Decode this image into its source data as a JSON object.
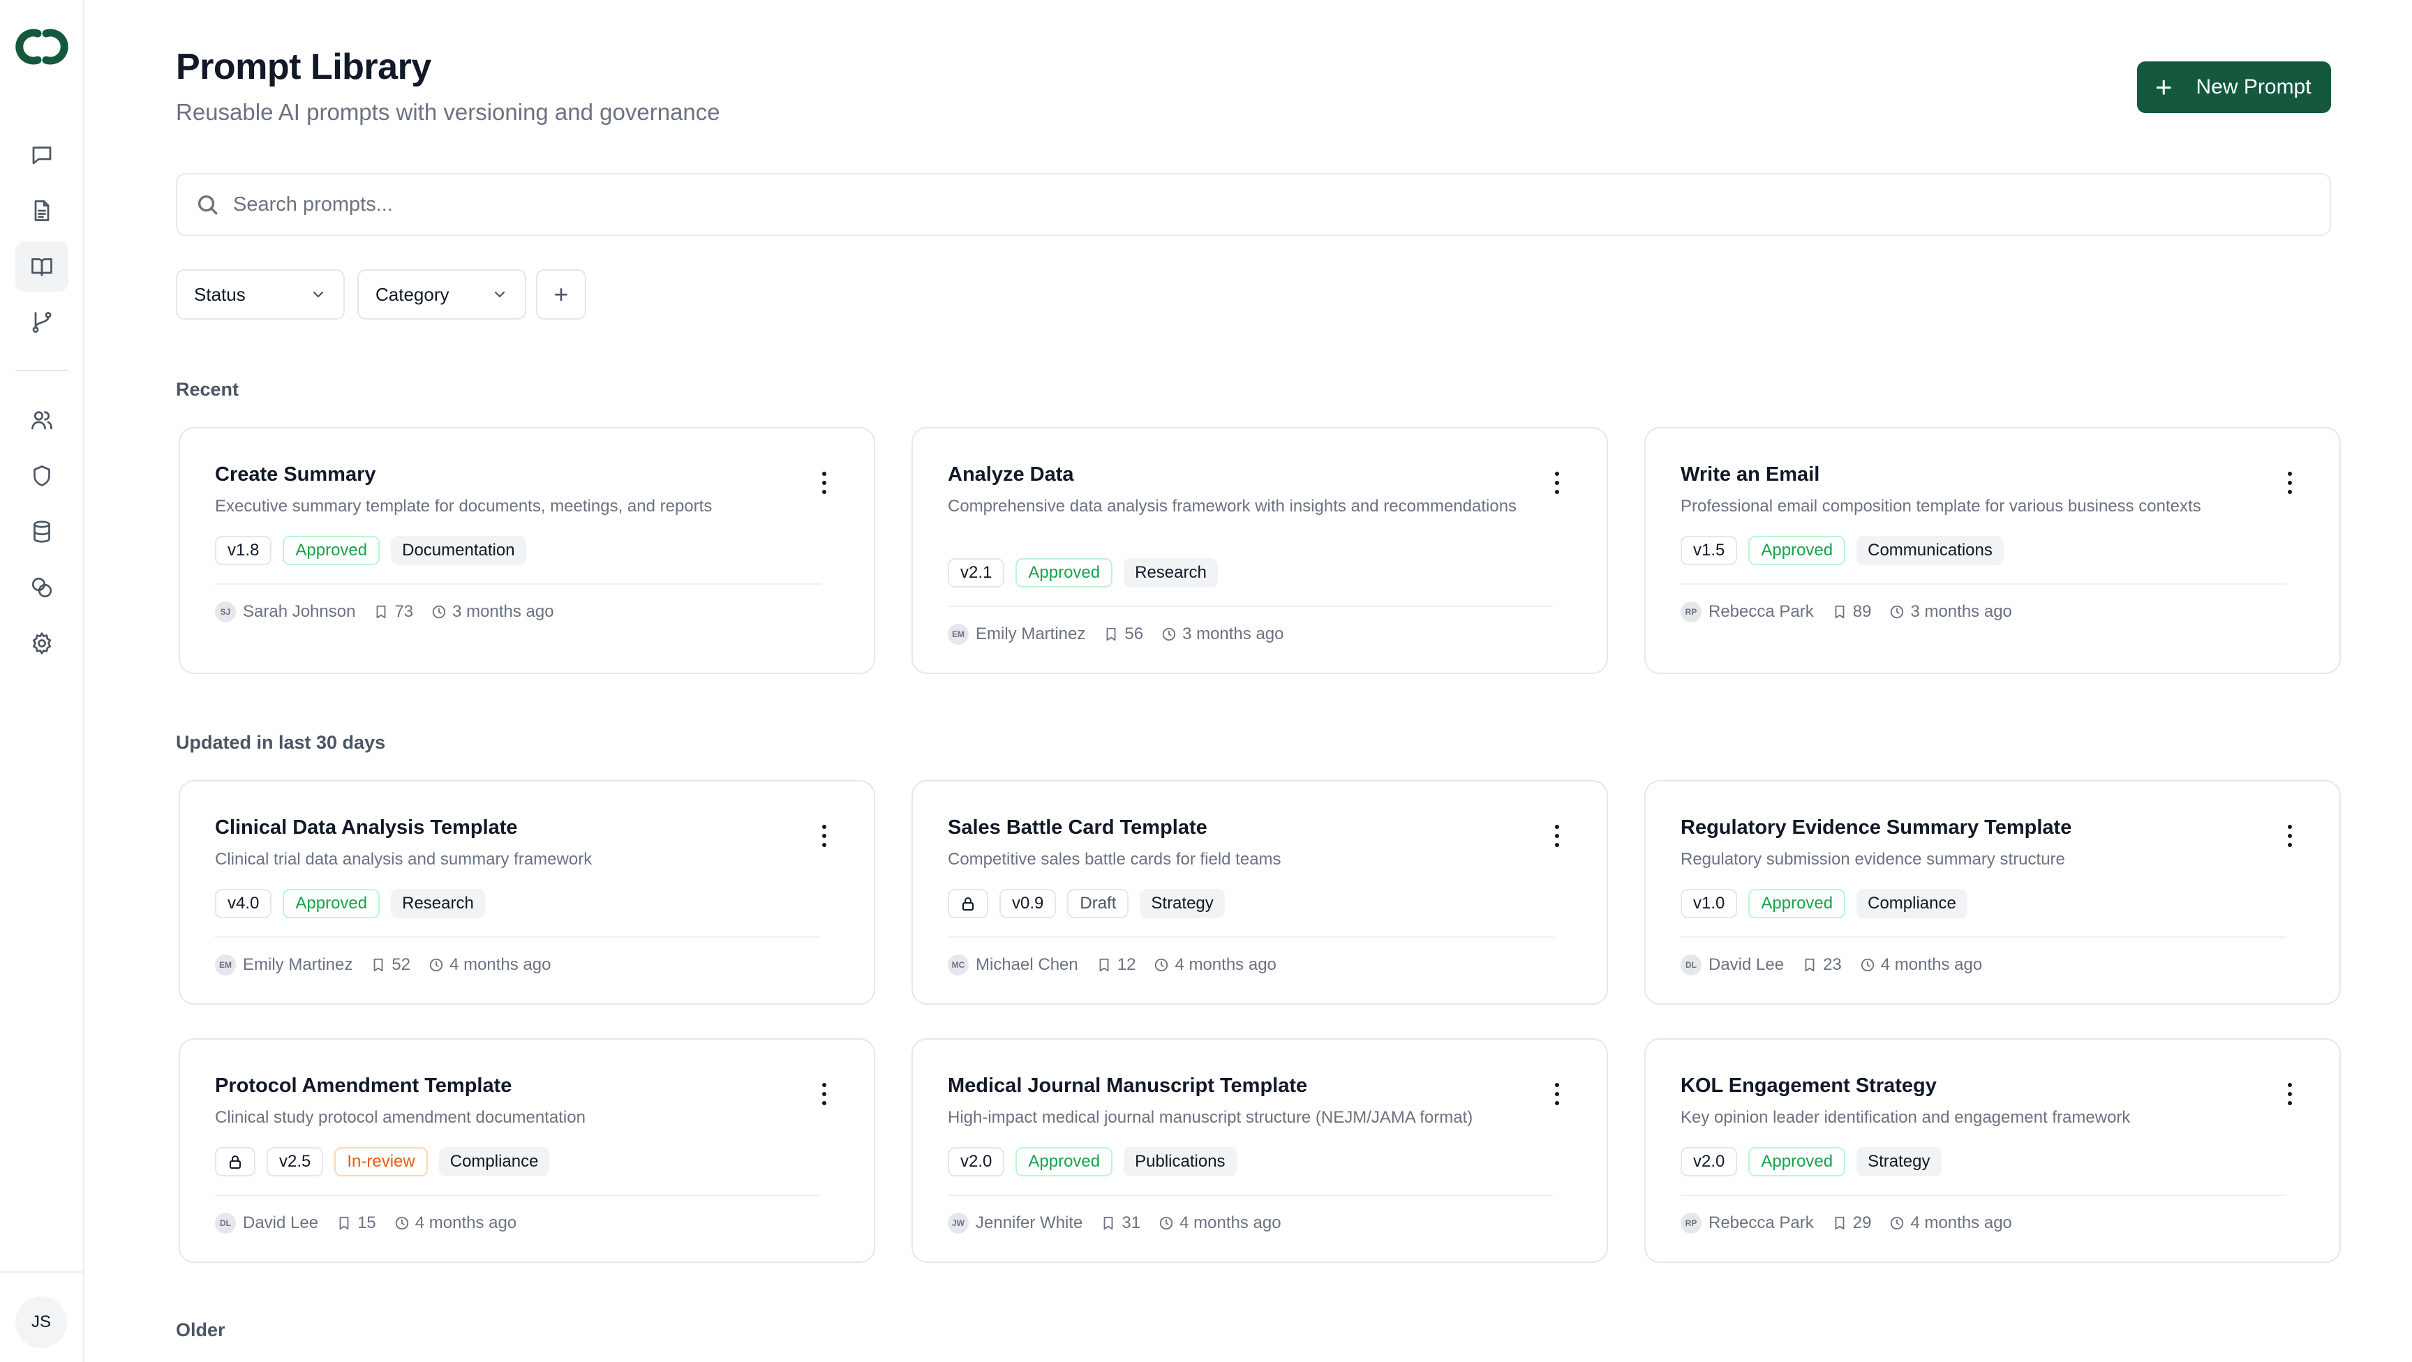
{
  "sidebar": {
    "nav": [
      {
        "name": "chat-icon",
        "active": false
      },
      {
        "name": "document-icon",
        "active": false
      },
      {
        "name": "book-open-icon",
        "active": true
      },
      {
        "name": "git-branch-icon",
        "active": false
      },
      {
        "name": "users-icon",
        "active": false
      },
      {
        "name": "shield-icon",
        "active": false
      },
      {
        "name": "database-icon",
        "active": false
      },
      {
        "name": "coins-icon",
        "active": false
      },
      {
        "name": "gear-icon",
        "active": false
      }
    ],
    "user_initials": "JS"
  },
  "header": {
    "title": "Prompt Library",
    "subtitle": "Reusable AI prompts with versioning and governance",
    "new_button": "New Prompt"
  },
  "search": {
    "placeholder": "Search prompts..."
  },
  "filters": {
    "status": "Status",
    "category": "Category",
    "add": "+"
  },
  "colors": {
    "brand": "#14593d",
    "approved": "#16a34a",
    "in_review": "#ea580c"
  },
  "sections": {
    "recent": "Recent",
    "updated": "Updated in last 30 days",
    "older": "Older"
  },
  "cards": {
    "recent": [
      {
        "title": "Create Summary",
        "desc": "Executive summary template for documents, meetings, and reports",
        "locked": false,
        "version": "v1.8",
        "status": "Approved",
        "status_type": "approved",
        "category": "Documentation",
        "initials": "SJ",
        "author": "Sarah Johnson",
        "uses": "73",
        "time": "3 months ago"
      },
      {
        "title": "Analyze Data",
        "desc": "Comprehensive data analysis framework with insights and recommendations",
        "locked": false,
        "version": "v2.1",
        "status": "Approved",
        "status_type": "approved",
        "category": "Research",
        "initials": "EM",
        "author": "Emily Martinez",
        "uses": "56",
        "time": "3 months ago"
      },
      {
        "title": "Write an Email",
        "desc": "Professional email composition template for various business contexts",
        "locked": false,
        "version": "v1.5",
        "status": "Approved",
        "status_type": "approved",
        "category": "Communications",
        "initials": "RP",
        "author": "Rebecca Park",
        "uses": "89",
        "time": "3 months ago"
      }
    ],
    "updated": [
      {
        "title": "Clinical Data Analysis Template",
        "desc": "Clinical trial data analysis and summary framework",
        "locked": false,
        "version": "v4.0",
        "status": "Approved",
        "status_type": "approved",
        "category": "Research",
        "initials": "EM",
        "author": "Emily Martinez",
        "uses": "52",
        "time": "4 months ago"
      },
      {
        "title": "Sales Battle Card Template",
        "desc": "Competitive sales battle cards for field teams",
        "locked": true,
        "version": "v0.9",
        "status": "Draft",
        "status_type": "draft",
        "category": "Strategy",
        "initials": "MC",
        "author": "Michael Chen",
        "uses": "12",
        "time": "4 months ago"
      },
      {
        "title": "Regulatory Evidence Summary Template",
        "desc": "Regulatory submission evidence summary structure",
        "locked": false,
        "version": "v1.0",
        "status": "Approved",
        "status_type": "approved",
        "category": "Compliance",
        "initials": "DL",
        "author": "David Lee",
        "uses": "23",
        "time": "4 months ago"
      },
      {
        "title": "Protocol Amendment Template",
        "desc": "Clinical study protocol amendment documentation",
        "locked": true,
        "version": "v2.5",
        "status": "In-review",
        "status_type": "review",
        "category": "Compliance",
        "initials": "DL",
        "author": "David Lee",
        "uses": "15",
        "time": "4 months ago"
      },
      {
        "title": "Medical Journal Manuscript Template",
        "desc": "High-impact medical journal manuscript structure (NEJM/JAMA format)",
        "locked": false,
        "version": "v2.0",
        "status": "Approved",
        "status_type": "approved",
        "category": "Publications",
        "initials": "JW",
        "author": "Jennifer White",
        "uses": "31",
        "time": "4 months ago"
      },
      {
        "title": "KOL Engagement Strategy",
        "desc": "Key opinion leader identification and engagement framework",
        "locked": false,
        "version": "v2.0",
        "status": "Approved",
        "status_type": "approved",
        "category": "Strategy",
        "initials": "RP",
        "author": "Rebecca Park",
        "uses": "29",
        "time": "4 months ago"
      }
    ]
  }
}
